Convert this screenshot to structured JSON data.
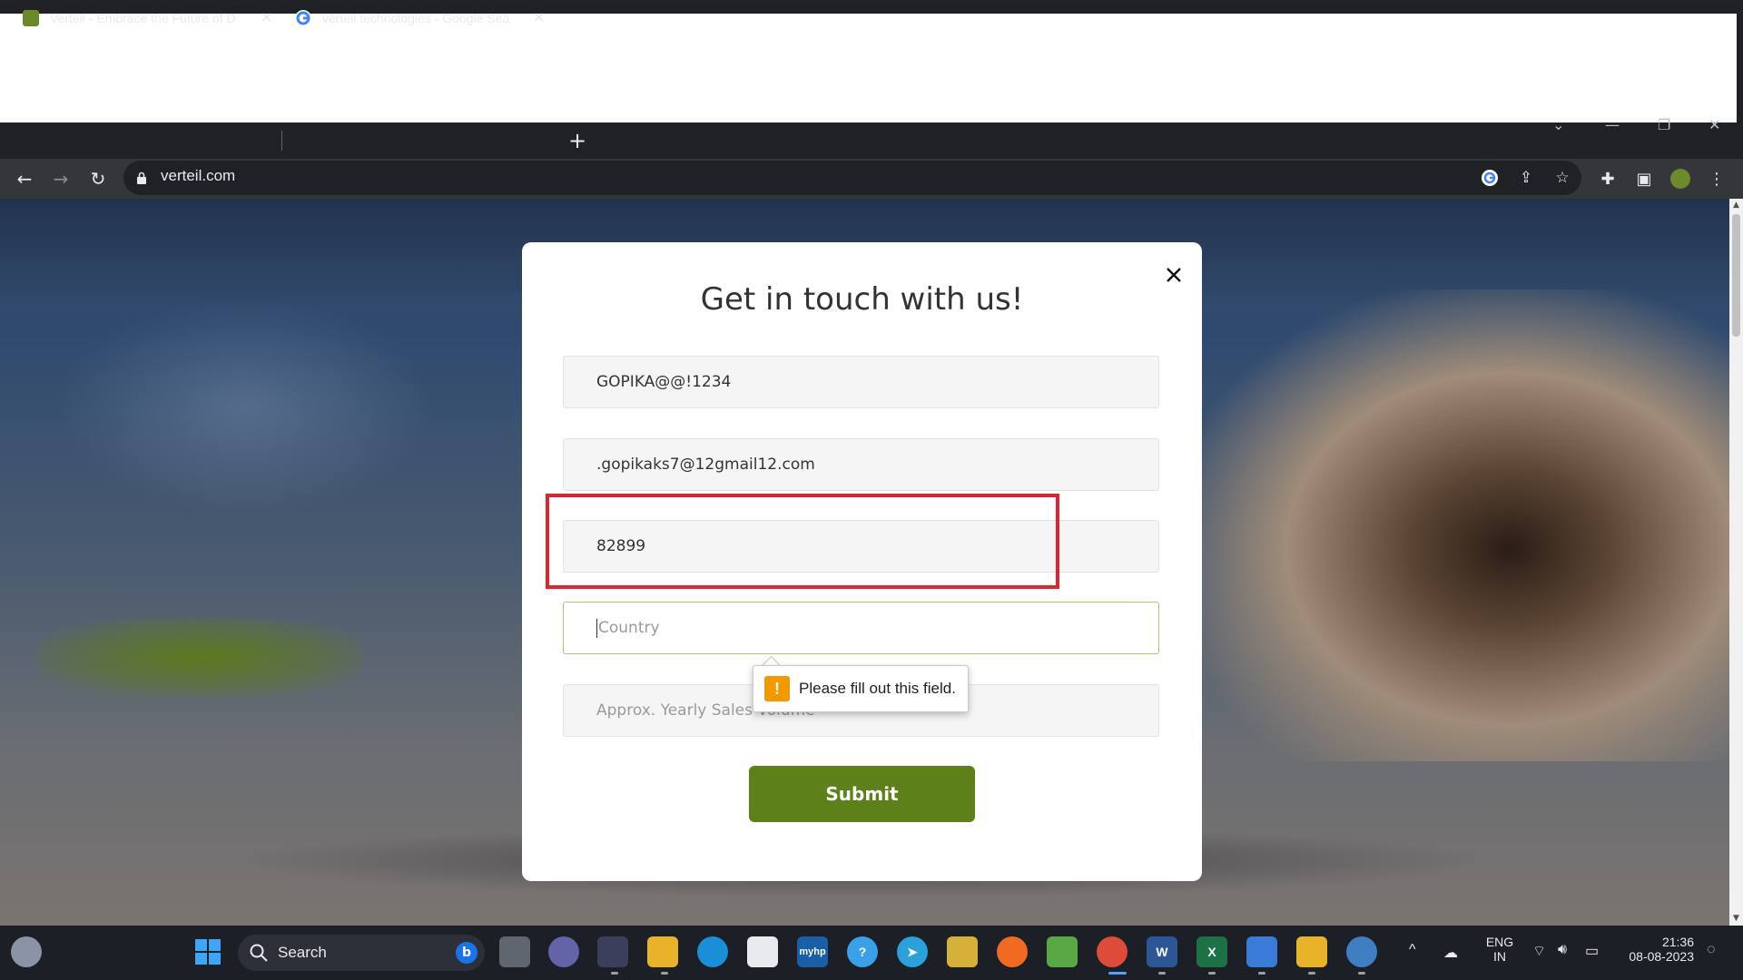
{
  "browser": {
    "tabs": [
      {
        "title": "Verteil - Embrace the Future of D",
        "favicon": "verteil-favicon",
        "favicon_color": "#6a8a2a"
      },
      {
        "title": "verteil technologies - Google Sea",
        "favicon": "google-favicon",
        "favicon_color": "#4285f4"
      }
    ],
    "new_tab_label": "+",
    "url": "verteil.com"
  },
  "modal": {
    "title": "Get in touch with us!",
    "name_value": "GOPIKA@@!1234",
    "email_value": ".gopikaks7@12gmail12.com",
    "phone_value": "82899",
    "country_placeholder": "Country",
    "sales_placeholder": "Approx. Yearly Sales Volume",
    "submit_label": "Submit",
    "validation_message": "Please fill out this field.",
    "accent_color": "#5e801a",
    "highlight_color": "#e0242e"
  },
  "taskbar": {
    "search_label": "Search",
    "language_top": "ENG",
    "language_bottom": "IN",
    "time": "21:36",
    "date": "08-08-2023"
  }
}
